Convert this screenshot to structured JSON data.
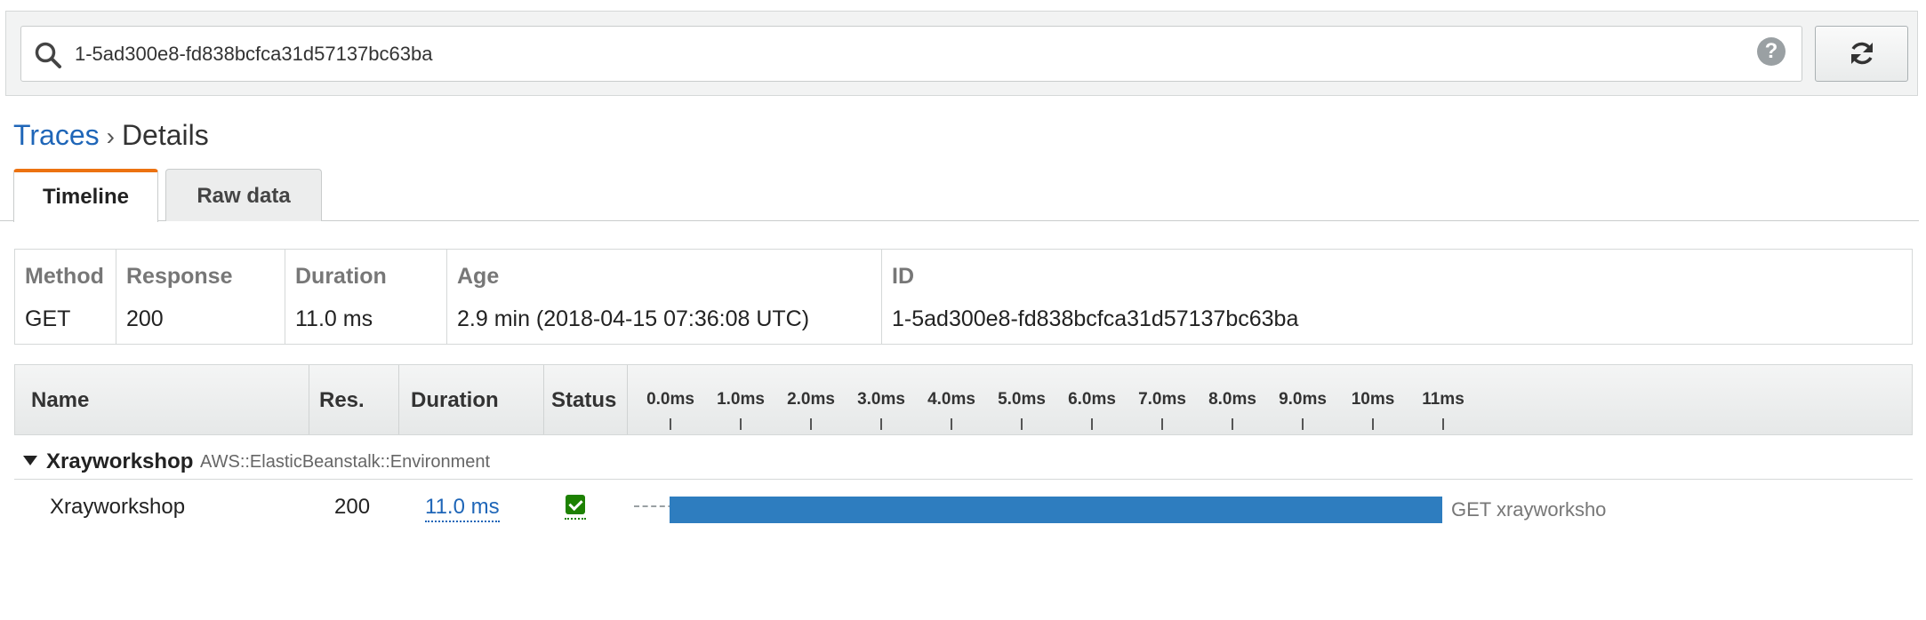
{
  "search": {
    "value": "1-5ad300e8-fd838bcfca31d57137bc63ba",
    "help_glyph": "?"
  },
  "breadcrumb": {
    "parent": "Traces",
    "separator": "›",
    "current": "Details"
  },
  "tabs": [
    {
      "label": "Timeline",
      "active": true
    },
    {
      "label": "Raw data",
      "active": false
    }
  ],
  "summary": {
    "headers": [
      "Method",
      "Response",
      "Duration",
      "Age",
      "ID"
    ],
    "values": [
      "GET",
      "200",
      "11.0 ms",
      "2.9 min (2018-04-15 07:36:08 UTC)",
      "1-5ad300e8-fd838bcfca31d57137bc63ba"
    ]
  },
  "timeline": {
    "columns": [
      "Name",
      "Res.",
      "Duration",
      "Status"
    ],
    "ticks": [
      "0.0ms",
      "1.0ms",
      "2.0ms",
      "3.0ms",
      "4.0ms",
      "5.0ms",
      "6.0ms",
      "7.0ms",
      "8.0ms",
      "9.0ms",
      "10ms",
      "11ms"
    ],
    "group": {
      "name": "Xrayworkshop",
      "type": "AWS::ElasticBeanstalk::Environment"
    },
    "segment": {
      "name": "Xrayworkshop",
      "response": "200",
      "duration": "11.0 ms",
      "status": "ok",
      "start_ms": 0.0,
      "end_ms": 11.0,
      "label": "GET xrayworksho"
    }
  },
  "colors": {
    "accent": "#ec7211",
    "link": "#1f66b8",
    "bar": "#2e7dbf",
    "status_ok": "#1d8102"
  },
  "icons": [
    "search-icon",
    "help-icon",
    "refresh-icon",
    "caret-down-icon",
    "check-icon"
  ]
}
